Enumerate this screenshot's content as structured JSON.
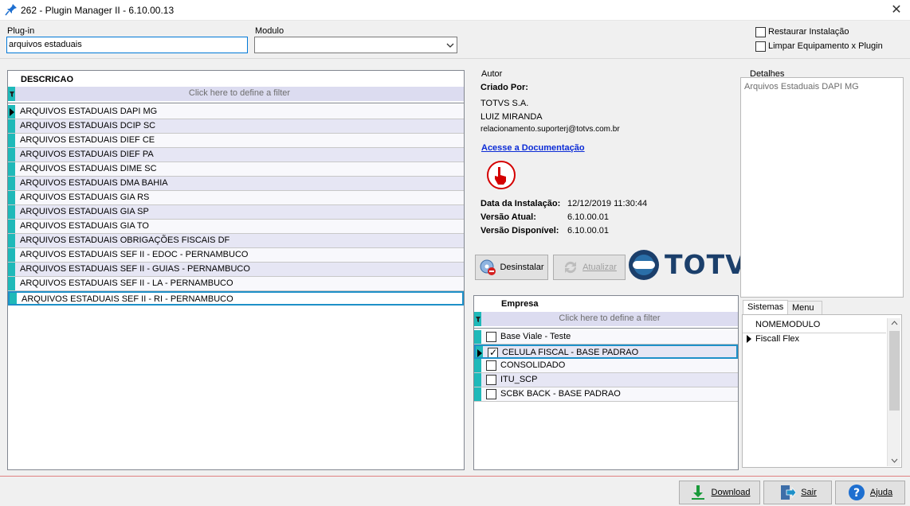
{
  "window": {
    "title": "262 - Plugin Manager II - 6.10.00.13"
  },
  "plugin": {
    "label": "Plug-in",
    "value": "arquivos estaduais"
  },
  "modulo": {
    "label": "Modulo",
    "value": ""
  },
  "options": {
    "restaurar": "Restaurar Instalação",
    "limpar": "Limpar Equipamento x Plugin"
  },
  "list": {
    "header": "DESCRICAO",
    "filter": "Click here to define a filter",
    "items": [
      "ARQUIVOS ESTADUAIS DAPI MG",
      "ARQUIVOS ESTADUAIS DCIP SC",
      "ARQUIVOS ESTADUAIS DIEF CE",
      "ARQUIVOS ESTADUAIS DIEF PA",
      "ARQUIVOS ESTADUAIS DIME SC",
      "ARQUIVOS ESTADUAIS DMA BAHIA",
      "ARQUIVOS ESTADUAIS GIA RS",
      "ARQUIVOS ESTADUAIS GIA SP",
      "ARQUIVOS ESTADUAIS GIA TO",
      "ARQUIVOS ESTADUAIS OBRIGAÇÕES FISCAIS DF",
      "ARQUIVOS ESTADUAIS SEF II - EDOC - PERNAMBUCO",
      "ARQUIVOS ESTADUAIS SEF II - GUIAS - PERNAMBUCO",
      "ARQUIVOS ESTADUAIS SEF II - LA - PERNAMBUCO",
      "ARQUIVOS ESTADUAIS SEF II - RI - PERNAMBUCO"
    ]
  },
  "autor": {
    "group": "Autor",
    "criado_label": "Criado Por:",
    "company": "TOTVS S.A.",
    "name": "LUIZ MIRANDA",
    "email": "relacionamento.suporterj@totvs.com.br",
    "doc_link": "Acesse a Documentação",
    "data_label": "Data da Instalação:",
    "data_value": "12/12/2019 11:30:44",
    "versao_atual_label": "Versão Atual:",
    "versao_atual_value": "6.10.00.01",
    "versao_disp_label": "Versão Disponível:",
    "versao_disp_value": "6.10.00.01"
  },
  "buttons": {
    "desinstalar": "Desinstalar",
    "atualizar": "Atualizar",
    "download": "Download",
    "sair": "Sair",
    "ajuda": "Ajuda"
  },
  "logo": {
    "text": "TOTVS"
  },
  "empresa": {
    "header": "Empresa",
    "filter": "Click here to define a filter",
    "items": [
      {
        "name": "Base Viale - Teste",
        "checked": false
      },
      {
        "name": "CELULA FISCAL - BASE PADRAO",
        "checked": true
      },
      {
        "name": "CONSOLIDADO",
        "checked": false
      },
      {
        "name": "ITU_SCP",
        "checked": false
      },
      {
        "name": "SCBK BACK - BASE PADRAO",
        "checked": false
      }
    ]
  },
  "detalhes": {
    "group": "Detalhes",
    "text": "Arquivos Estaduais DAPI MG"
  },
  "tabs": {
    "sistemas": "Sistemas",
    "menu": "Menu"
  },
  "sistemas": {
    "header": "NOMEMODULO",
    "items": [
      "Fiscall Flex"
    ]
  },
  "colors": {
    "accent": "#1e90c8",
    "indicator": "#1fb9b9",
    "link": "#0b2bd6",
    "logo": "#1b3f6b"
  }
}
